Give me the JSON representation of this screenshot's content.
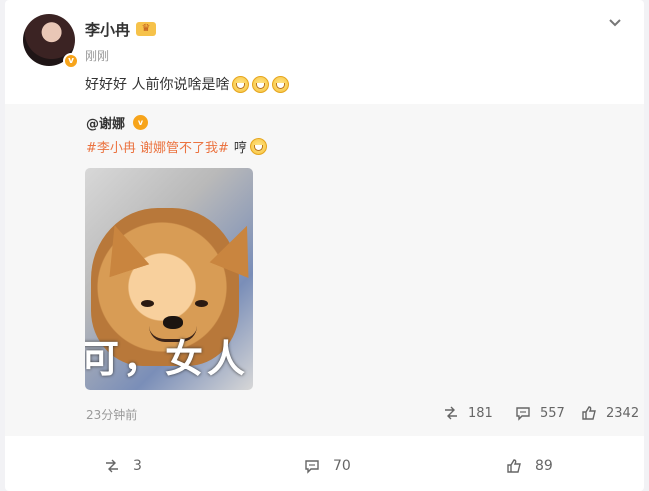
{
  "post": {
    "author": "李小冉",
    "time": "刚刚",
    "text": "好好好 人前你说啥是啥"
  },
  "repost": {
    "author": "@谢娜",
    "hashtag": "#李小冉 谢娜管不了我#",
    "text": "哼",
    "time": "23分钟前",
    "meme_caption": "可，女人",
    "stats": {
      "repost": "181",
      "comment": "557",
      "like": "2342"
    }
  },
  "actions": {
    "repost": "3",
    "comment": "70",
    "like": "89"
  },
  "colors": {
    "hashtag": "#eb7340",
    "verified": "#f7a41b"
  },
  "icons": [
    "verified-icon",
    "crown-icon",
    "more-icon",
    "emoji-icon",
    "repost-icon",
    "comment-icon",
    "like-icon"
  ]
}
